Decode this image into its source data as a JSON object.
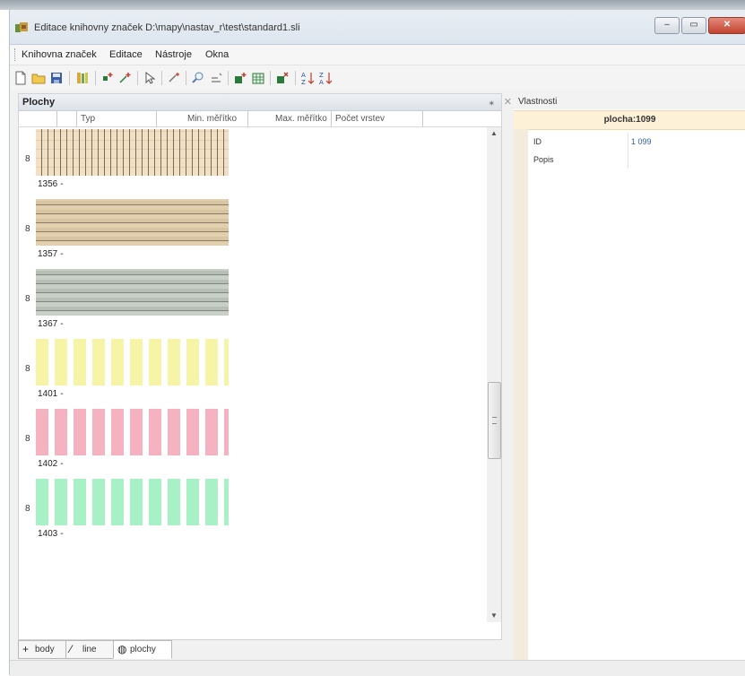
{
  "window": {
    "title": "Editace knihovny značek D:\\mapy\\nastav_r\\test\\standard1.sli",
    "buttons": {
      "minimize": "–",
      "maximize": "▭",
      "close": "✕"
    }
  },
  "menu": {
    "items": [
      "Knihovna značek",
      "Editace",
      "Nástroje",
      "Okna"
    ]
  },
  "toolbar": {
    "icons": [
      "new-icon",
      "open-folder-icon",
      "save-icon",
      "library-icon",
      "add-symbol-icon",
      "add-line-icon",
      "select-icon",
      "move-icon",
      "zoom-icon",
      "edit-icon",
      "add-area-icon",
      "area-table-icon",
      "delete-area-icon",
      "sort-ascending-icon",
      "sort-descending-icon"
    ]
  },
  "left_pane": {
    "title": "Plochy",
    "pin": "⁎",
    "close": "✕",
    "columns": [
      "",
      "",
      "Typ",
      "Min. měřítko",
      "Max. měřítko",
      "Počet vrstev"
    ],
    "rows": [
      {
        "mark": "8",
        "id": "1356",
        "suffix": "-",
        "pattern": "hatch-sand"
      },
      {
        "mark": "8",
        "id": "1357",
        "suffix": "-",
        "pattern": "hatch-brown"
      },
      {
        "mark": "8",
        "id": "1367",
        "suffix": "-",
        "pattern": "hatch-gray"
      },
      {
        "mark": "8",
        "id": "1401",
        "suffix": "-",
        "pattern": "stripes-yellow"
      },
      {
        "mark": "8",
        "id": "1402",
        "suffix": "-",
        "pattern": "stripes-pink"
      },
      {
        "mark": "8",
        "id": "1403",
        "suffix": "-",
        "pattern": "stripes-green"
      }
    ]
  },
  "tabs": [
    {
      "icon": "plus-icon",
      "glyph": "+",
      "label": "body",
      "active": false
    },
    {
      "icon": "line-icon",
      "glyph": "⁄",
      "label": "line",
      "active": false
    },
    {
      "icon": "area-icon",
      "glyph": "◍",
      "label": "plochy",
      "active": true
    }
  ],
  "properties": {
    "title": "Vlastnosti",
    "selected": "plocha:1099",
    "rows": [
      {
        "key": "ID",
        "value": "1 099"
      },
      {
        "key": "Popis",
        "value": ""
      }
    ]
  },
  "colors": {
    "window_bg": "#f1f1f1",
    "selected_row_bg": "#fdf1d8",
    "id_value": "#2f5fb3",
    "close_button": "#c0442f"
  }
}
